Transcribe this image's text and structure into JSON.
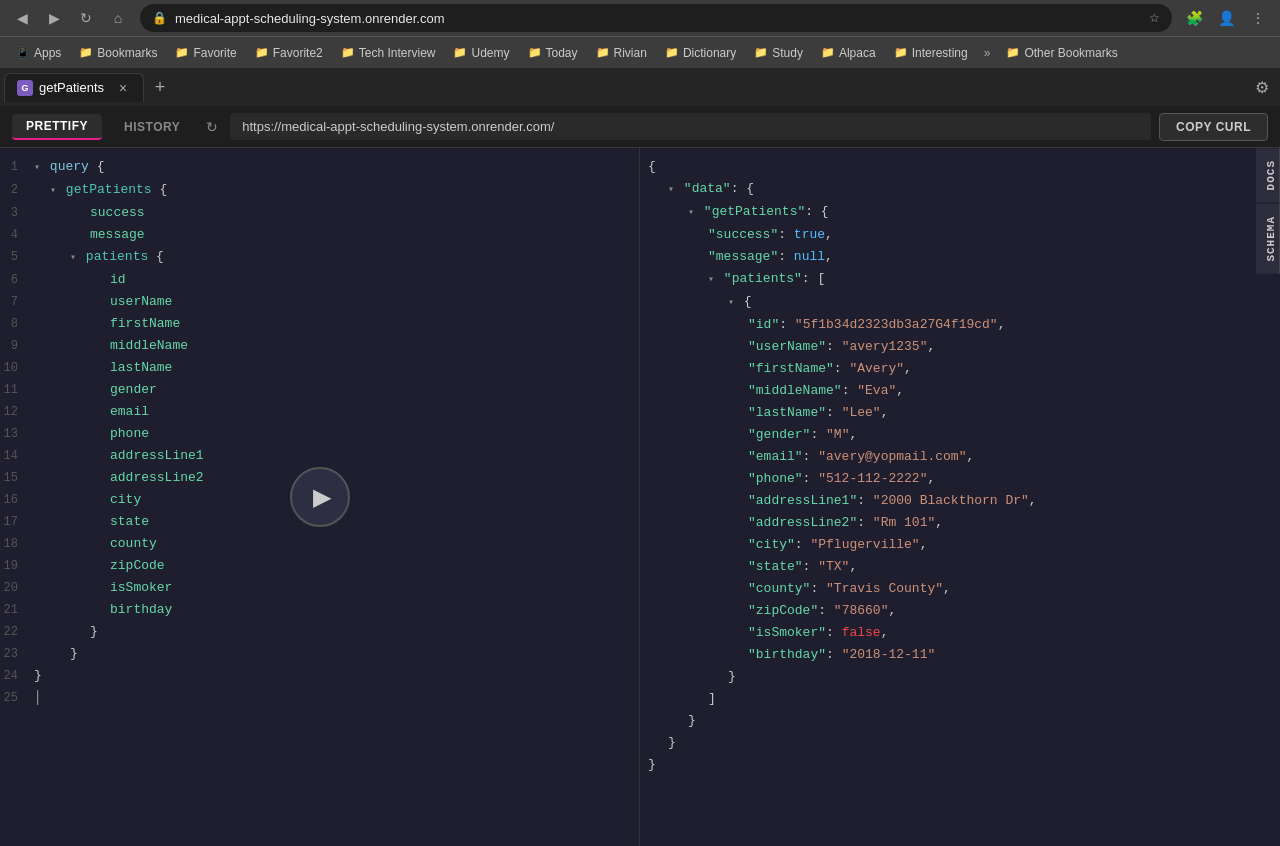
{
  "browser": {
    "url": "medical-appt-scheduling-system.onrender.com",
    "back_icon": "◀",
    "forward_icon": "▶",
    "reload_icon": "↻",
    "home_icon": "⌂",
    "extensions": [
      "🔒",
      "⭐",
      "☰"
    ],
    "profile_icon": "👤",
    "menu_icon": "⋮"
  },
  "bookmarks": [
    {
      "label": "Apps",
      "icon": "📱"
    },
    {
      "label": "Bookmarks",
      "icon": "📁"
    },
    {
      "label": "Favorite",
      "icon": "📁"
    },
    {
      "label": "Favorite2",
      "icon": "📁"
    },
    {
      "label": "Tech Interview",
      "icon": "📁"
    },
    {
      "label": "Udemy",
      "icon": "📁"
    },
    {
      "label": "Today",
      "icon": "📁"
    },
    {
      "label": "Rivian",
      "icon": "📁"
    },
    {
      "label": "Dictionary",
      "icon": "📁"
    },
    {
      "label": "Study",
      "icon": "📁"
    },
    {
      "label": "Alpaca",
      "icon": "📁"
    },
    {
      "label": "Interesting",
      "icon": "📁"
    },
    {
      "label": "»",
      "icon": ""
    },
    {
      "label": "Other Bookmarks",
      "icon": "📁"
    }
  ],
  "tab": {
    "title": "getPatients",
    "icon_letter": "G",
    "close_icon": "×"
  },
  "toolbar": {
    "prettify_label": "PRETTIFY",
    "history_label": "HISTORY",
    "url": "https://medical-appt-scheduling-system.onrender.com/",
    "copy_curl_label": "COPY CURL",
    "refresh_icon": "↻"
  },
  "settings_icon": "⚙",
  "add_tab_icon": "+",
  "query_lines": [
    {
      "num": "1",
      "content": "▾ query {",
      "type": "heading"
    },
    {
      "num": "2",
      "content": "  ▾ getPatients {",
      "type": "typename"
    },
    {
      "num": "3",
      "content": "        success",
      "type": "field"
    },
    {
      "num": "4",
      "content": "        message",
      "type": "field"
    },
    {
      "num": "5",
      "content": "    ▾ patients {",
      "type": "typename"
    },
    {
      "num": "6",
      "content": "          id",
      "type": "field"
    },
    {
      "num": "7",
      "content": "          userName",
      "type": "field"
    },
    {
      "num": "8",
      "content": "          firstName",
      "type": "field"
    },
    {
      "num": "9",
      "content": "          middleName",
      "type": "field"
    },
    {
      "num": "10",
      "content": "          lastName",
      "type": "field"
    },
    {
      "num": "11",
      "content": "          gender",
      "type": "field"
    },
    {
      "num": "12",
      "content": "          email",
      "type": "field"
    },
    {
      "num": "13",
      "content": "          phone",
      "type": "field"
    },
    {
      "num": "14",
      "content": "          addressLine1",
      "type": "field"
    },
    {
      "num": "15",
      "content": "          addressLine2",
      "type": "field"
    },
    {
      "num": "16",
      "content": "          city",
      "type": "field"
    },
    {
      "num": "17",
      "content": "          state",
      "type": "field"
    },
    {
      "num": "18",
      "content": "          county",
      "type": "field"
    },
    {
      "num": "19",
      "content": "          zipCode",
      "type": "field"
    },
    {
      "num": "20",
      "content": "          isSmoker",
      "type": "field"
    },
    {
      "num": "21",
      "content": "          birthday",
      "type": "field"
    },
    {
      "num": "22",
      "content": "      }",
      "type": "brace"
    },
    {
      "num": "23",
      "content": "  }",
      "type": "brace"
    },
    {
      "num": "24",
      "content": "}",
      "type": "brace"
    },
    {
      "num": "25",
      "content": "",
      "type": "empty"
    }
  ],
  "response": {
    "side_tabs": [
      "DOCS",
      "SCHEMA"
    ],
    "lines": [
      {
        "indent": 0,
        "text": "{",
        "type": "brace"
      },
      {
        "indent": 1,
        "collapse": "▾",
        "text": "\"data\": {",
        "key": "data",
        "type": "key-obj"
      },
      {
        "indent": 2,
        "collapse": "▾",
        "text": "\"getPatients\": {",
        "key": "getPatients",
        "type": "key-obj"
      },
      {
        "indent": 3,
        "text": "\"success\": true,",
        "key": "success",
        "val": "true",
        "valtype": "bool-true"
      },
      {
        "indent": 3,
        "text": "\"message\": null,",
        "key": "message",
        "val": "null",
        "valtype": "null"
      },
      {
        "indent": 3,
        "collapse": "▾",
        "text": "\"patients\": [",
        "key": "patients",
        "type": "key-arr"
      },
      {
        "indent": 4,
        "collapse": "▾",
        "text": "{",
        "type": "brace"
      },
      {
        "indent": 5,
        "text": "\"id\": \"5f1b34d2323db3a27G4f19cd\",",
        "key": "id",
        "val": "\"5f1b34d2323db3a27G4f19cd\"",
        "valtype": "string"
      },
      {
        "indent": 5,
        "text": "\"userName\": \"avery1235\",",
        "key": "userName",
        "val": "\"avery1235\"",
        "valtype": "string"
      },
      {
        "indent": 5,
        "text": "\"firstName\": \"Avery\",",
        "key": "firstName",
        "val": "\"Avery\"",
        "valtype": "string"
      },
      {
        "indent": 5,
        "text": "\"middleName\": \"Eva\",",
        "key": "middleName",
        "val": "\"Eva\"",
        "valtype": "string"
      },
      {
        "indent": 5,
        "text": "\"lastName\": \"Lee\",",
        "key": "lastName",
        "val": "\"Lee\"",
        "valtype": "string"
      },
      {
        "indent": 5,
        "text": "\"gender\": \"M\",",
        "key": "gender",
        "val": "\"M\"",
        "valtype": "string"
      },
      {
        "indent": 5,
        "text": "\"email\": \"avery@yopmail.com\",",
        "key": "email",
        "val": "\"avery@yopmail.com\"",
        "valtype": "string"
      },
      {
        "indent": 5,
        "text": "\"phone\": \"512-112-2222\",",
        "key": "phone",
        "val": "\"512-112-2222\"",
        "valtype": "string"
      },
      {
        "indent": 5,
        "text": "\"addressLine1\": \"2000 Blackthorn Dr\",",
        "key": "addressLine1",
        "val": "\"2000 Blackthorn Dr\"",
        "valtype": "string"
      },
      {
        "indent": 5,
        "text": "\"addressLine2\": \"Rm 101\",",
        "key": "addressLine2",
        "val": "\"Rm 101\"",
        "valtype": "string"
      },
      {
        "indent": 5,
        "text": "\"city\": \"Pflugerville\",",
        "key": "city",
        "val": "\"Pflugerville\"",
        "valtype": "string"
      },
      {
        "indent": 5,
        "text": "\"state\": \"TX\",",
        "key": "state",
        "val": "\"TX\"",
        "valtype": "string"
      },
      {
        "indent": 5,
        "text": "\"county\": \"Travis County\",",
        "key": "county",
        "val": "\"Travis County\"",
        "valtype": "string"
      },
      {
        "indent": 5,
        "text": "\"zipCode\": \"78660\",",
        "key": "zipCode",
        "val": "\"78660\"",
        "valtype": "string"
      },
      {
        "indent": 5,
        "text": "\"isSmoker\": false,",
        "key": "isSmoker",
        "val": "false",
        "valtype": "bool-false"
      },
      {
        "indent": 5,
        "text": "\"birthday\": \"2018-12-11\"",
        "key": "birthday",
        "val": "\"2018-12-11\"",
        "valtype": "string"
      },
      {
        "indent": 4,
        "text": "}",
        "type": "brace"
      },
      {
        "indent": 3,
        "text": "]",
        "type": "brace"
      },
      {
        "indent": 2,
        "text": "}",
        "type": "brace"
      },
      {
        "indent": 1,
        "text": "}",
        "type": "brace"
      },
      {
        "indent": 0,
        "text": "}",
        "type": "brace"
      }
    ]
  }
}
